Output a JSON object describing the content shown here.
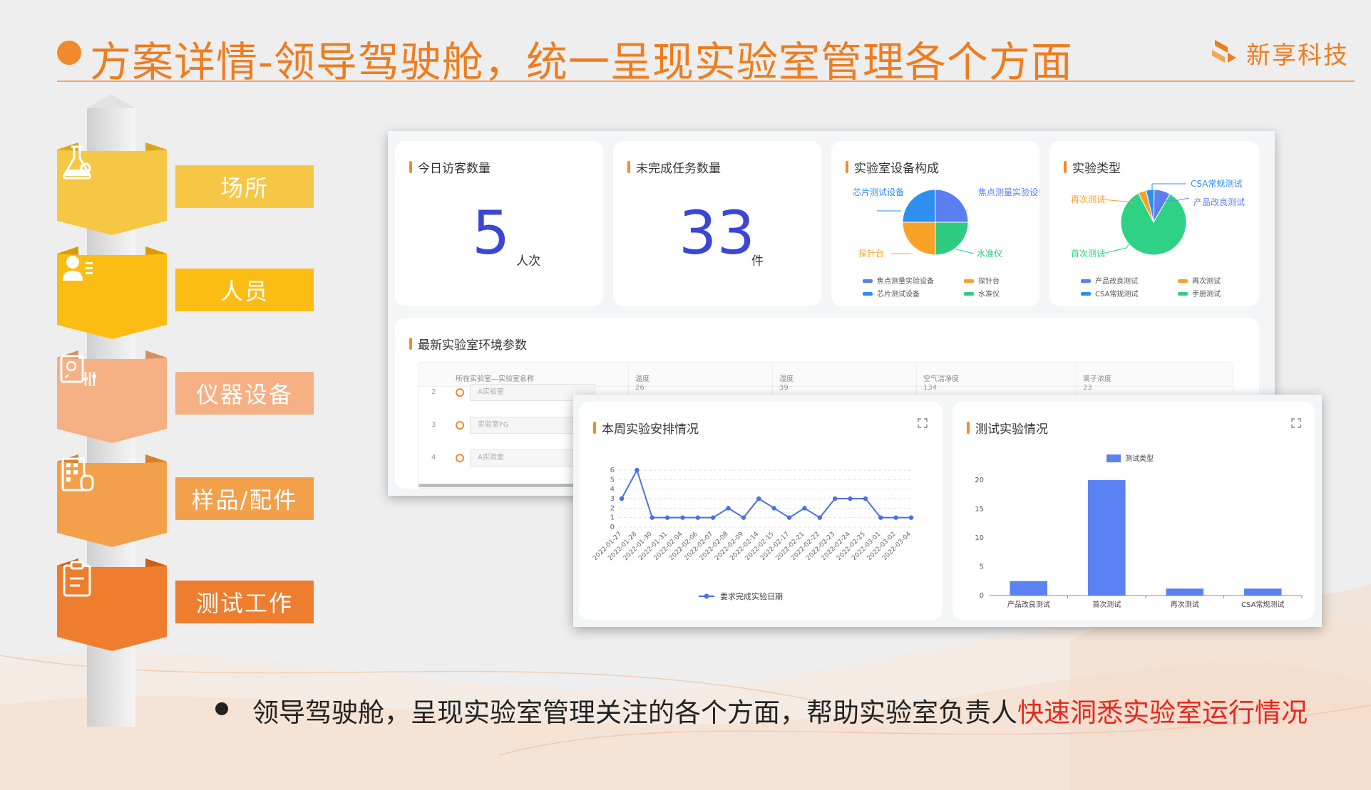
{
  "header": {
    "title": "方案详情-领导驾驶舱，统一呈现实验室管理各个方面",
    "logo_text": "新享科技",
    "accent": "#ee7d1f"
  },
  "categories": [
    {
      "label": "场所",
      "icon": "flask-icon",
      "color": "#f5c744",
      "label_bg": "#f5c744"
    },
    {
      "label": "人员",
      "icon": "person-card-icon",
      "color": "#fbbd14",
      "label_bg": "#fbbd14"
    },
    {
      "label": "仪器设备",
      "icon": "instrument-icon",
      "color": "#f5b084",
      "label_bg": "#f5b084"
    },
    {
      "label": "样品/配件",
      "icon": "sample-kit-icon",
      "color": "#f3a04b",
      "label_bg": "#f3a04b"
    },
    {
      "label": "测试工作",
      "icon": "clipboard-icon",
      "color": "#ee7d2e",
      "label_bg": "#ee7d2e"
    }
  ],
  "dashboard": {
    "visitors": {
      "title": "今日访客数量",
      "value": "5",
      "unit": "人次"
    },
    "tasks": {
      "title": "未完成任务数量",
      "value": "33",
      "unit": "件"
    },
    "equipment": {
      "title": "实验室设备构成",
      "slice_labels": [
        "芯片测试设备",
        "焦点测量实验设备",
        "水准仪",
        "探针台"
      ],
      "legend": [
        "焦点测量实验设备",
        "探针台",
        "芯片测试设备",
        "水准仪"
      ]
    },
    "exp_type": {
      "title": "实验类型",
      "slice_labels": [
        "CSA常规测试",
        "产品改良测试",
        "再次测试",
        "首次测试"
      ],
      "legend": [
        "产品改良测试",
        "再次测试",
        "CSA常规测试",
        "手册测试"
      ]
    },
    "env": {
      "title": "最新实验室环境参数",
      "columns": [
        "所在实验室—实验室名称",
        "温度",
        "湿度",
        "空气洁净度",
        "离子浓度"
      ],
      "rows": [
        {
          "no": "2",
          "lab": "A实验室",
          "temp": "26",
          "hum": "39",
          "air": "134",
          "ion": "23"
        },
        {
          "no": "3",
          "lab": "实验室FG"
        },
        {
          "no": "4",
          "lab": "A实验室"
        }
      ]
    },
    "weekly": {
      "title": "本周实验安排情况",
      "legend": "要求完成实验日期"
    },
    "tests": {
      "title": "测试实验情况",
      "legend": "测试类型"
    }
  },
  "note": {
    "text": "领导驾驶舱，呈现实验室管理关注的各个方面，帮助实验室负责人",
    "highlight": "快速洞悉实验室运行情况",
    "highlight_color": "#e8271d"
  },
  "chart_data": [
    {
      "type": "pie",
      "categories": [
        "焦点测量实验设备",
        "水准仪",
        "探针台",
        "芯片测试设备"
      ],
      "values": [
        25,
        25,
        25,
        25
      ],
      "colors": [
        "#5b7ff0",
        "#2ecc80",
        "#f7a227",
        "#2f8ff0"
      ]
    },
    {
      "type": "pie",
      "categories": [
        "首次测试",
        "再次测试",
        "产品改良测试",
        "CSA常规测试"
      ],
      "values": [
        84,
        4,
        4,
        8
      ],
      "colors": [
        "#2fd184",
        "#f7a227",
        "#2f8ff0",
        "#5b7ff0"
      ]
    },
    {
      "type": "line",
      "x": [
        "2022-01-27",
        "2022-01-28",
        "2022-01-30",
        "2022-01-31",
        "2022-02-04",
        "2022-02-06",
        "2022-02-07",
        "2022-02-08",
        "2022-02-09",
        "2022-02-14",
        "2022-02-15",
        "2022-02-17",
        "2022-02-21",
        "2022-02-22",
        "2022-02-23",
        "2022-02-24",
        "2022-02-25",
        "2022-03-01",
        "2022-03-02",
        "2022-03-04"
      ],
      "series": [
        {
          "name": "要求完成实验日期",
          "values": [
            3,
            6,
            1,
            1,
            1,
            1,
            1,
            2,
            1,
            3,
            2,
            1,
            2,
            1,
            3,
            3,
            3,
            1,
            1,
            1
          ]
        }
      ],
      "yticks": [
        0,
        1,
        2,
        3,
        4,
        5,
        6
      ],
      "ylim": [
        0,
        6
      ],
      "grid": true,
      "color": "#4a6fe3"
    },
    {
      "type": "bar",
      "categories": [
        "产品改良测试",
        "首次测试",
        "再次测试",
        "CSA常规测试"
      ],
      "series": [
        {
          "name": "测试类型",
          "values": [
            2.5,
            20,
            1.2,
            1.2
          ]
        }
      ],
      "yticks": [
        0,
        5,
        10,
        15,
        20
      ],
      "ylim": [
        0,
        20
      ],
      "color": "#5b82f2"
    }
  ]
}
